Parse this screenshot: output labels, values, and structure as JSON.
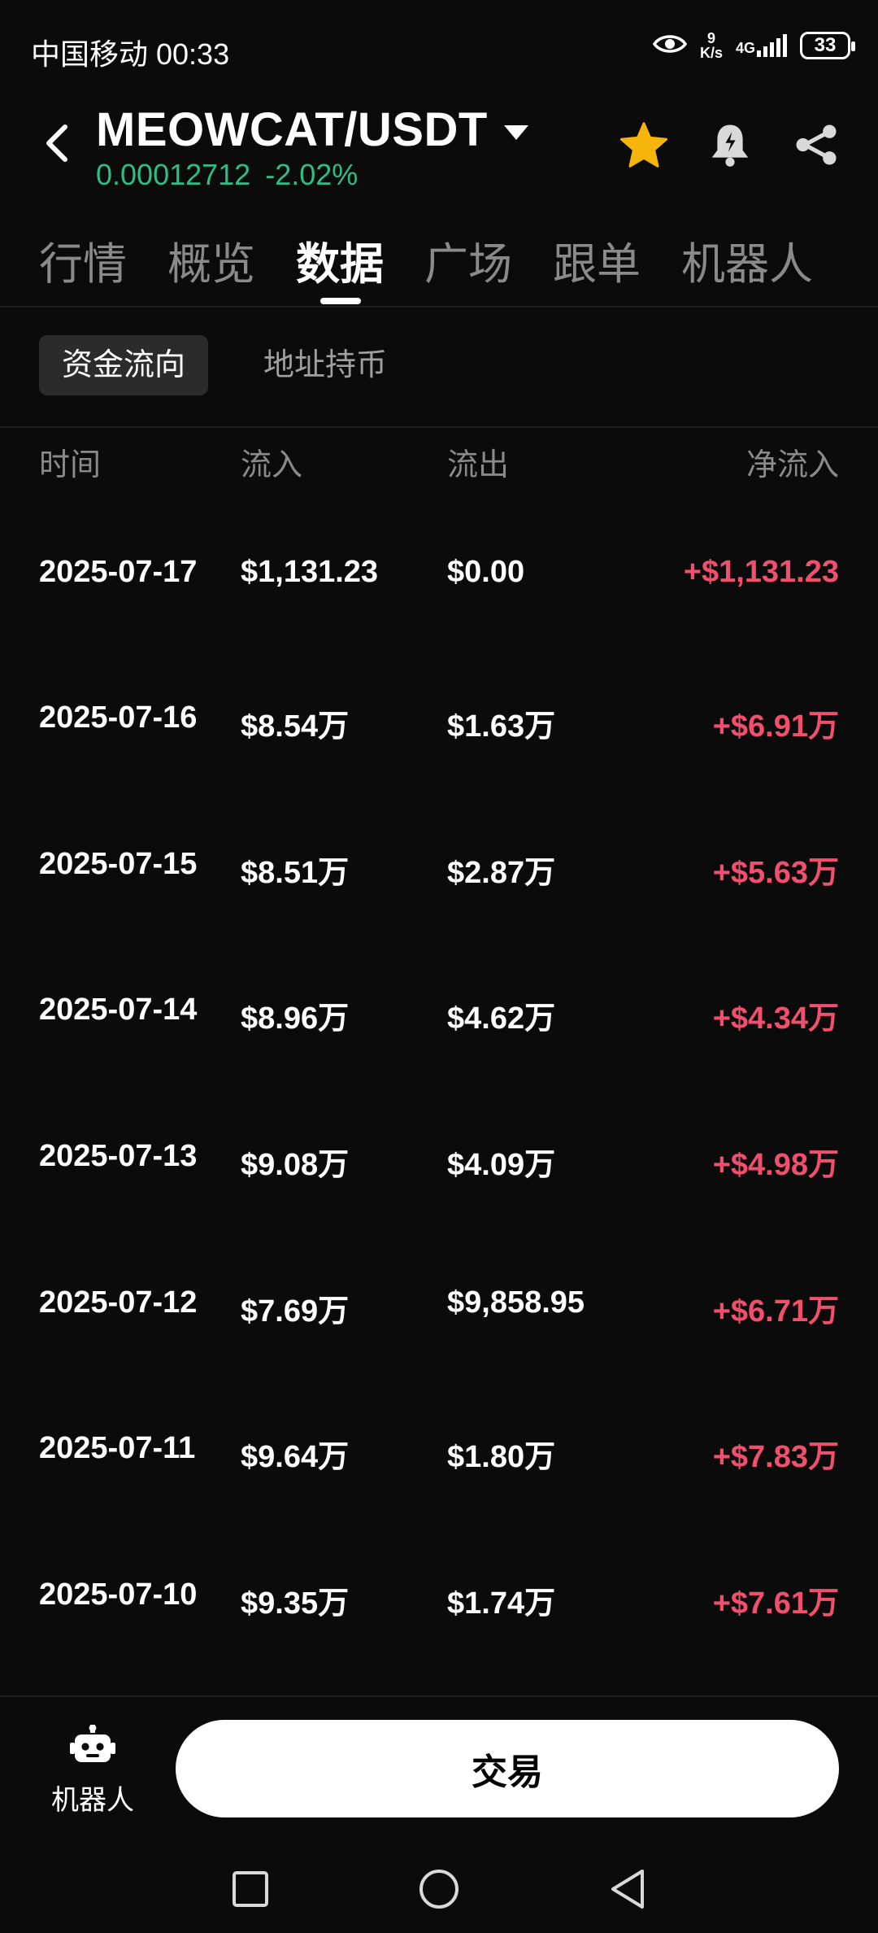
{
  "status": {
    "carrier_time": "中国移动 00:33",
    "speed_top": "9",
    "speed_bottom": "K/s",
    "network": "4G",
    "battery": "33"
  },
  "header": {
    "pair": "MEOWCAT/USDT",
    "price": "0.00012712",
    "change": "-2.02%",
    "price_color": "#2ebd85",
    "star_color": "#f5b50a"
  },
  "tabs": [
    "行情",
    "概览",
    "数据",
    "广场",
    "跟单",
    "机器人"
  ],
  "active_tab": "数据",
  "subtabs": [
    "资金流向",
    "地址持币"
  ],
  "table": {
    "headers": [
      "时间",
      "流入",
      "流出",
      "净流入"
    ],
    "rows": [
      [
        "2025-07-17",
        "$1,131.23",
        "$0.00",
        "+$1,131.23"
      ],
      [
        "2025-07-16",
        "$8.54万",
        "$1.63万",
        "+$6.91万"
      ],
      [
        "2025-07-15",
        "$8.51万",
        "$2.87万",
        "+$5.63万"
      ],
      [
        "2025-07-14",
        "$8.96万",
        "$4.62万",
        "+$4.34万"
      ],
      [
        "2025-07-13",
        "$9.08万",
        "$4.09万",
        "+$4.98万"
      ],
      [
        "2025-07-12",
        "$7.69万",
        "$9,858.95",
        "+$6.71万"
      ],
      [
        "2025-07-11",
        "$9.64万",
        "$1.80万",
        "+$7.83万"
      ],
      [
        "2025-07-10",
        "$9.35万",
        "$1.74万",
        "+$7.61万"
      ]
    ],
    "net_color": "#f0506e"
  },
  "bottom": {
    "robot_label": "机器人",
    "trade_label": "交易"
  }
}
